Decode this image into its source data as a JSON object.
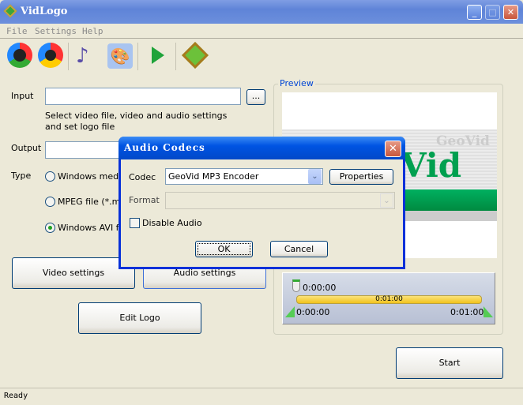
{
  "window": {
    "title": "VidLogo",
    "icon": "vidlogo-icon"
  },
  "menu": [
    "File",
    "Settings",
    "Help"
  ],
  "toolbar": [
    "open-video-icon",
    "batch-video-icon",
    "audio-icon",
    "logo-paint-icon",
    "play-icon",
    "film-icon"
  ],
  "main": {
    "input_label": "Input",
    "input_value": "",
    "browse_label": "...",
    "hint": [
      "Select video file, video and audio settings",
      "and set logo file"
    ],
    "output_label": "Output",
    "output_value": "",
    "type_label": "Type",
    "types": [
      {
        "label": "Windows media",
        "selected": false
      },
      {
        "label": "MPEG file (*.mpg",
        "selected": false
      },
      {
        "label": "Windows AVI file",
        "selected": true
      }
    ],
    "video_settings": "Video settings",
    "audio_settings": "Audio settings",
    "edit_logo": "Edit Logo",
    "start": "Start"
  },
  "preview": {
    "label": "Preview",
    "logo_text": "Vid",
    "logo_small": "GeoVid"
  },
  "timeline": {
    "current": "0:00:00",
    "duration": "0:01:00",
    "start": "0:00:00",
    "end": "0:01:00"
  },
  "status": "Ready",
  "dialog": {
    "title": "Audio Codecs",
    "codec_label": "Codec",
    "codec_value": "GeoVid MP3 Encoder",
    "properties": "Properties",
    "format_label": "Format",
    "format_value": "",
    "disable_audio": "Disable Audio",
    "disable_checked": false,
    "ok": "OK",
    "cancel": "Cancel"
  },
  "colors": {
    "accent": "#0054e3",
    "preview_label": "#0046d5",
    "logo_green": "#00a050",
    "timeline_bar": "#f7d344"
  }
}
